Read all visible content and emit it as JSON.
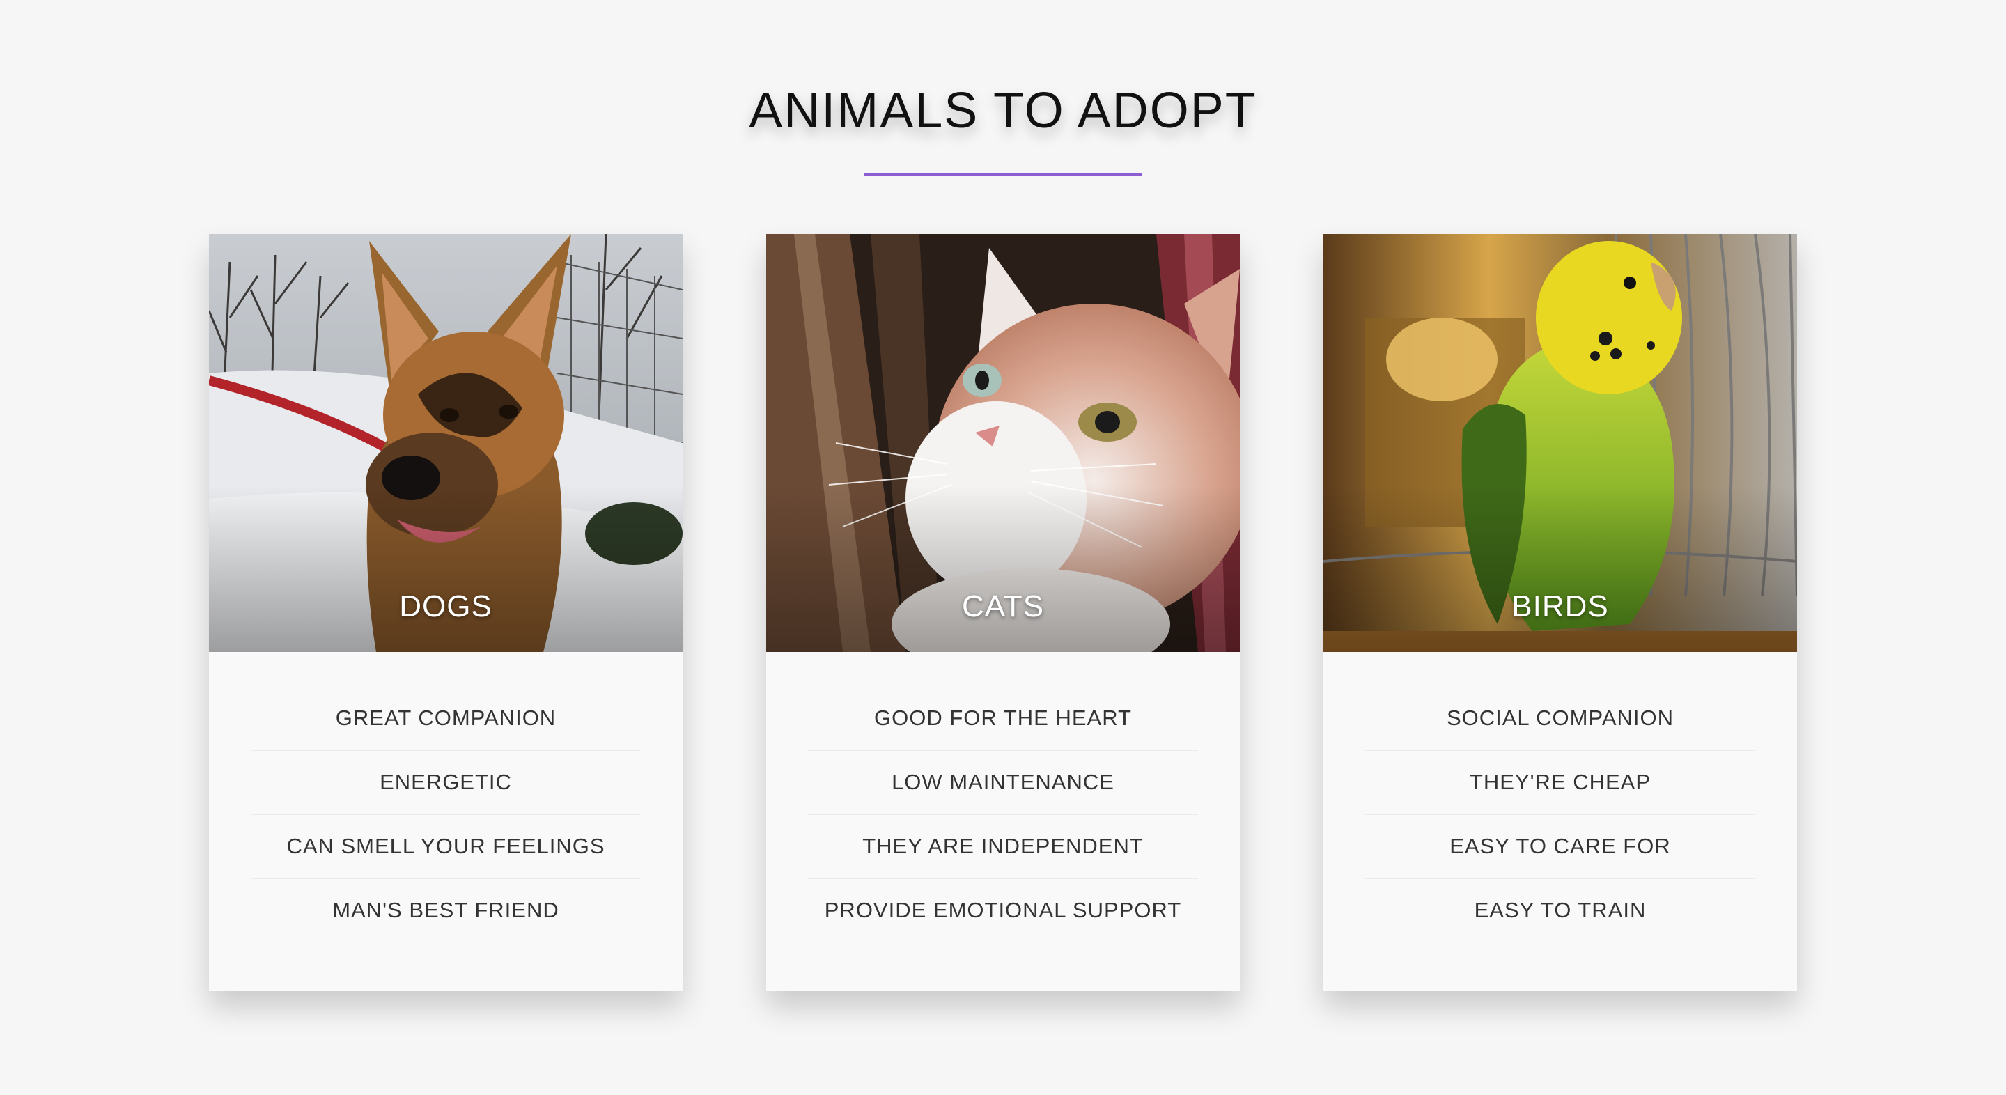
{
  "page": {
    "title": "ANIMALS TO ADOPT",
    "accent_color": "#8d5ed2"
  },
  "cards": [
    {
      "caption": "DOGS",
      "photo": "dog-photo",
      "features": [
        "GREAT COMPANION",
        "ENERGETIC",
        "CAN SMELL YOUR FEELINGS",
        "MAN'S BEST FRIEND"
      ]
    },
    {
      "caption": "CATS",
      "photo": "cat-photo",
      "features": [
        "GOOD FOR THE HEART",
        "LOW MAINTENANCE",
        "THEY ARE INDEPENDENT",
        "PROVIDE EMOTIONAL SUPPORT"
      ]
    },
    {
      "caption": "BIRDS",
      "photo": "bird-photo",
      "features": [
        "SOCIAL COMPANION",
        "THEY'RE CHEAP",
        "EASY TO CARE FOR",
        "EASY TO TRAIN"
      ]
    }
  ]
}
